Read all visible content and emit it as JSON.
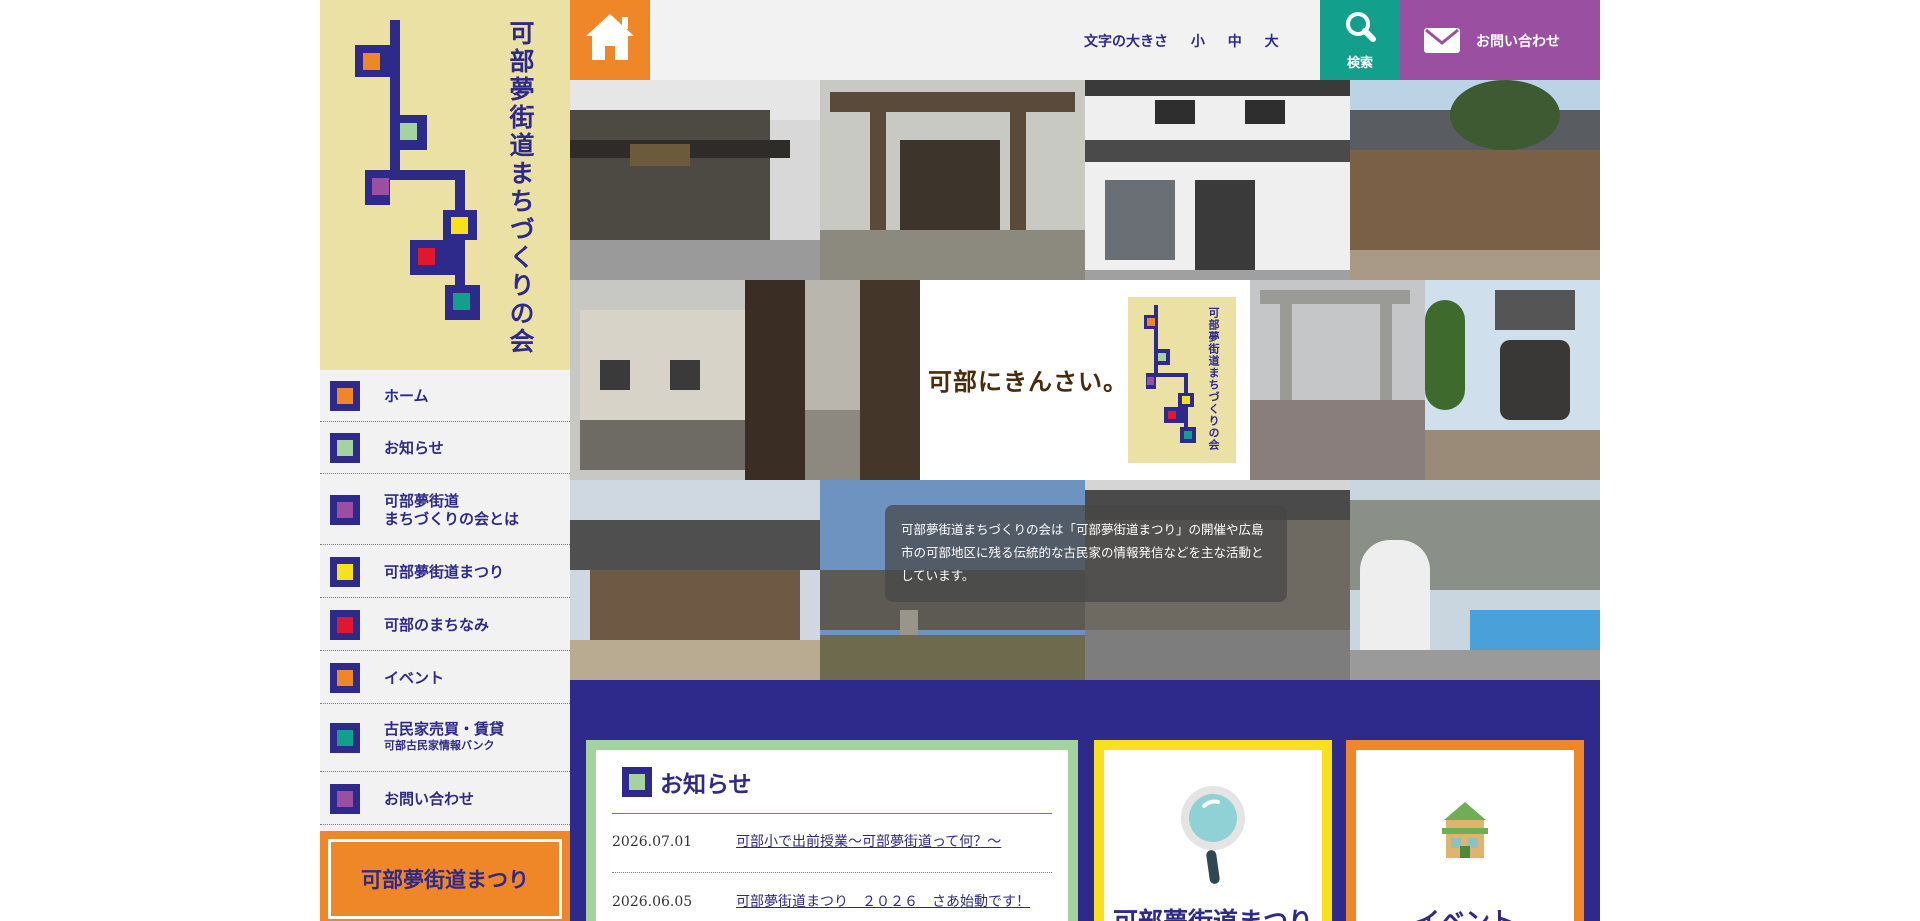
{
  "site": {
    "title": "可部夢街道まちづくりの会",
    "brand_color": "#2e2a8c"
  },
  "header": {
    "home_icon": "home-icon",
    "font_size_label": "文字の大きさ",
    "font_sizes": [
      "小",
      "中",
      "大"
    ],
    "search_label": "検索",
    "contact_label": "お問い合わせ"
  },
  "nav": [
    {
      "label": "ホーム",
      "sub": "",
      "color": "#ef8627"
    },
    {
      "label": "お知らせ",
      "sub": "",
      "color": "#a4d3a0"
    },
    {
      "label": "可部夢街道\nまちづくりの会とは",
      "sub": "",
      "color": "#9b4fa0"
    },
    {
      "label": "可部夢街道まつり",
      "sub": "",
      "color": "#f7e11a"
    },
    {
      "label": "可部のまちなみ",
      "sub": "",
      "color": "#e0182d"
    },
    {
      "label": "イベント",
      "sub": "",
      "color": "#ef8627"
    },
    {
      "label": "古民家売買・賃貸",
      "sub": "可部古民家情報バンク",
      "color": "#12a08c"
    },
    {
      "label": "お問い合わせ",
      "sub": "",
      "color": "#9b4fa0"
    }
  ],
  "sidebar_banner": "可部夢街道まつり",
  "hero": {
    "catchphrase": "可部にきんさい。",
    "caption": "可部夢街道まちづくりの会は「可部夢街道まつり」の開催や広島市の可部地区に残る伝統的な古民家の情報発信などを主な活動としています。",
    "slides": 4,
    "active_slide": 1
  },
  "news": {
    "title": "お知らせ",
    "items": [
      {
        "date": "2026.07.01",
        "title": "可部小で出前授業〜可部夢街道って何？〜"
      },
      {
        "date": "2026.06.05",
        "title": "可部夢街道まつり　２０２６　さあ始動です！"
      }
    ]
  },
  "cards": [
    {
      "label": "可部夢街道まつり",
      "icon": "magnifier-icon",
      "color": "#f7e11a"
    },
    {
      "label": "イベント",
      "icon": "house-icon",
      "color": "#ef8627"
    }
  ]
}
